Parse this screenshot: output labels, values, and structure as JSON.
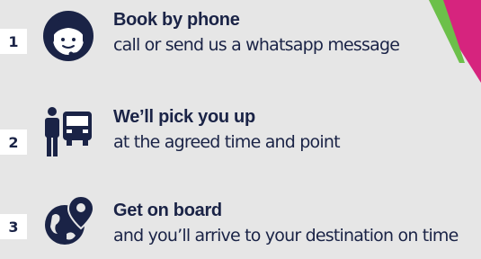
{
  "steps": [
    {
      "number": "1",
      "title": "Book by phone",
      "description": "call or send us a whatsapp message",
      "icon": "headset-person-icon"
    },
    {
      "number": "2",
      "title": "We’ll pick you up",
      "description": "at the agreed time and point",
      "icon": "person-and-bus-icon"
    },
    {
      "number": "3",
      "title": "Get on board",
      "description": "and you’ll arrive to your destination on time",
      "icon": "globe-location-pin-icon"
    }
  ],
  "colors": {
    "text": "#1a2346",
    "badge_bg": "#ffffff",
    "accent_green": "#6cc04a",
    "accent_magenta": "#d6247e",
    "background": "#e6e6e6"
  }
}
